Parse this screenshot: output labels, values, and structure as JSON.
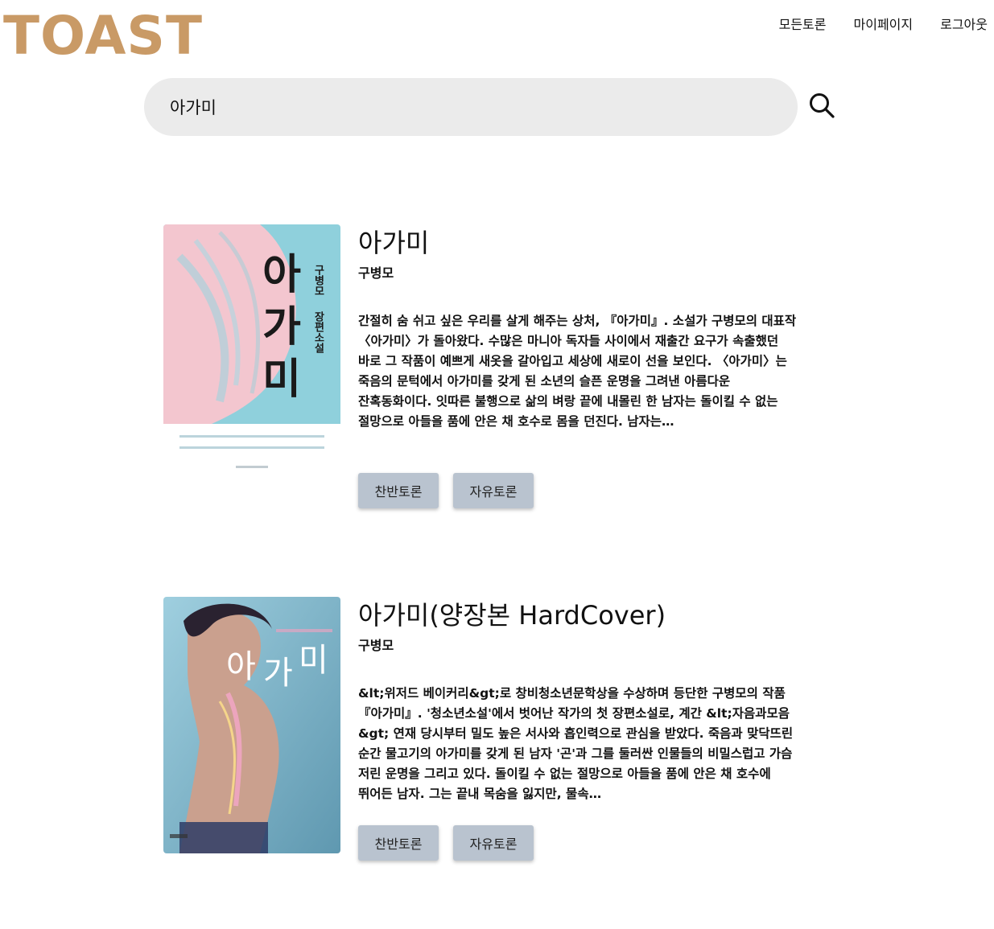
{
  "brand": {
    "logo_text": "TOAST"
  },
  "nav": {
    "items": [
      {
        "label": "모든토론"
      },
      {
        "label": "마이페이지"
      },
      {
        "label": "로그아웃"
      }
    ]
  },
  "search": {
    "value": "아가미",
    "button_icon": "search-icon"
  },
  "results": [
    {
      "title": "아가미",
      "author": "구병모",
      "description": "간절히 숨 쉬고 싶은 우리를 살게 해주는 상처, 『아가미』. 소설가 구병모의 대표작 〈아가미〉가 돌아왔다. 수많은 마니아 독자들 사이에서 재출간 요구가 속출했던 바로 그 작품이 예쁘게 새옷을 갈아입고 세상에 새로이 선을 보인다. 〈아가미〉는 죽음의 문턱에서 아가미를 갖게 된 소년의 슬픈 운명을 그려낸 아름다운 잔혹동화이다. 잇따른 불행으로 삶의 벼랑 끝에 내몰린 한 남자는 돌이킬 수 없는 절망으로 아들을 품에 안은 채 호수로 몸을 던진다. 남자는…",
      "cover": {
        "big_chars": [
          "아",
          "가",
          "미"
        ],
        "side_text": [
          "구병모",
          "장편소설"
        ],
        "colors": {
          "background": "#8fd0dc",
          "shape": "#f3c6cf"
        }
      },
      "buttons": {
        "debate_pros_cons": "찬반토론",
        "debate_free": "자유토론"
      }
    },
    {
      "title": "아가미(양장본 HardCover)",
      "author": "구병모",
      "description": "&lt;위저드 베이커리&gt;로 창비청소년문학상을 수상하며 등단한 구병모의 작품 『아가미』. '청소년소설'에서 벗어난 작가의 첫 장편소설로, 계간 &lt;자음과모음&gt; 연재 당시부터 밀도 높은 서사와 흡인력으로 관심을 받았다. 죽음과 맞닥뜨린 순간 물고기의 아가미를 갖게 된 남자 '곤'과 그를 둘러싼 인물들의 비밀스럽고 가슴 저린 운명을 그리고 있다. 돌이킬 수 없는 절망으로 아들을 품에 안은 채 호수에 뛰어든 남자. 그는 끝내 목숨을 잃지만, 물속…",
      "cover": {
        "big_chars": [
          "아",
          "가",
          "미"
        ],
        "colors": {
          "background": "#7fb6cc",
          "figure": "#caa08e"
        }
      },
      "buttons": {
        "debate_pros_cons": "찬반토론",
        "debate_free": "자유토론"
      }
    }
  ]
}
